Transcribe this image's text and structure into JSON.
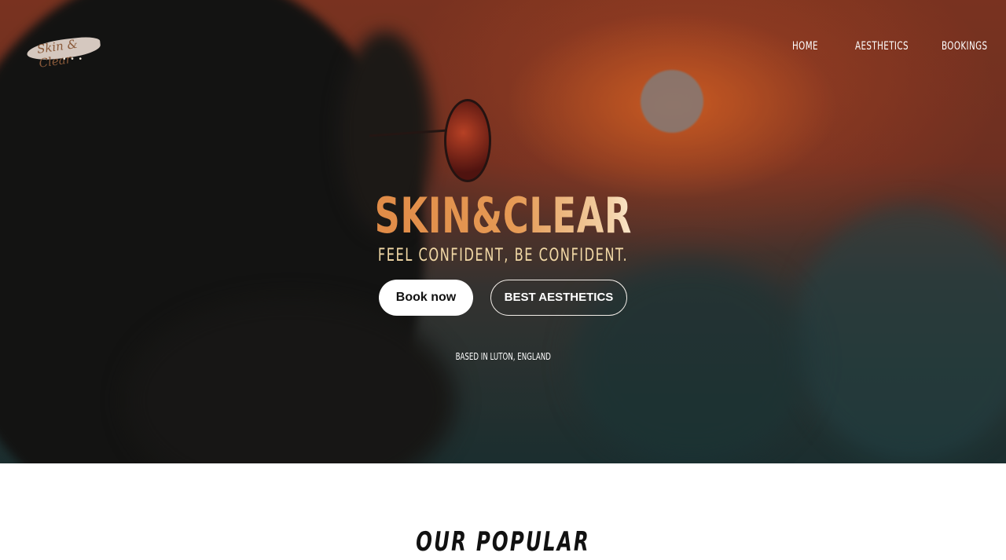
{
  "brand": {
    "logo_text": "Skin & Clear"
  },
  "nav": {
    "items": [
      {
        "label": "HOME"
      },
      {
        "label": "AESTHETICS"
      },
      {
        "label": "BOOKINGS"
      }
    ]
  },
  "hero": {
    "title": "SKIN&CLEAR",
    "tagline": "FEEL CONFIDENT, BE CONFIDENT.",
    "primary_button": "Book now",
    "secondary_button": "BEST AESTHETICS",
    "location": "BASED IN LUTON, ENGLAND"
  },
  "section": {
    "title": "OUR POPULAR"
  },
  "colors": {
    "title_gradient_start": "#e08b47",
    "title_gradient_end": "#fbe7cc",
    "tagline": "#f2d9a6",
    "button_primary_bg": "#ffffff"
  }
}
